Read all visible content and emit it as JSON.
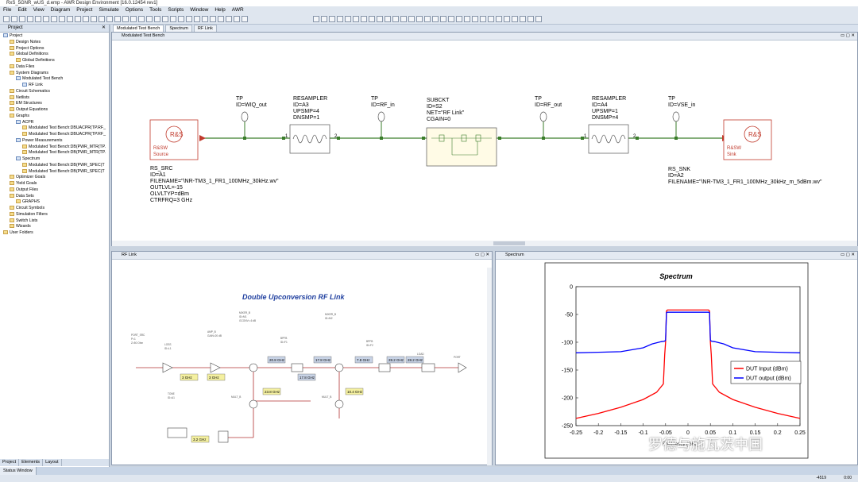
{
  "window_title": "RxS_5GNR_wUS_d.emp - AWR Design Environment [16.0.12454 rev1]",
  "menu": [
    "File",
    "Edit",
    "View",
    "Diagram",
    "Project",
    "Simulate",
    "Options",
    "Tools",
    "Scripts",
    "Window",
    "Help",
    "AWR"
  ],
  "doc_tabs": [
    "Modulated Test Bench",
    "Spectrum",
    "RF Link"
  ],
  "left_pane_title": "Project",
  "tree": [
    {
      "label": "Project",
      "indent": 0,
      "kind": "g"
    },
    {
      "label": "Design Notes",
      "indent": 1
    },
    {
      "label": "Project Options",
      "indent": 1
    },
    {
      "label": "Global Definitions",
      "indent": 1
    },
    {
      "label": "Global Definitions",
      "indent": 2
    },
    {
      "label": "Data Files",
      "indent": 1
    },
    {
      "label": "System Diagrams",
      "indent": 1
    },
    {
      "label": "Modulated Test Bench",
      "indent": 2,
      "kind": "g"
    },
    {
      "label": "RF Link",
      "indent": 3,
      "kind": "g"
    },
    {
      "label": "Circuit Schematics",
      "indent": 1
    },
    {
      "label": "Netlists",
      "indent": 1
    },
    {
      "label": "EM Structures",
      "indent": 1
    },
    {
      "label": "Output Equations",
      "indent": 1
    },
    {
      "label": "Graphs",
      "indent": 1
    },
    {
      "label": "ACPR",
      "indent": 2,
      "kind": "g"
    },
    {
      "label": "Modulated Test Bench:DBUACPR(TP.RF_",
      "indent": 3
    },
    {
      "label": "Modulated Test Bench:DBUACPR(TP.RF_",
      "indent": 3
    },
    {
      "label": "Power Measurements",
      "indent": 2,
      "kind": "g"
    },
    {
      "label": "Modulated Test Bench:DB(PWR_MTR(TP.",
      "indent": 3
    },
    {
      "label": "Modulated Test Bench:DB(PWR_MTR(TP.",
      "indent": 3
    },
    {
      "label": "Spectrum",
      "indent": 2,
      "kind": "g"
    },
    {
      "label": "Modulated Test Bench:DB(PWR_SPEC(T",
      "indent": 3
    },
    {
      "label": "Modulated Test Bench:DB(PWR_SPEC(T",
      "indent": 3
    },
    {
      "label": "Optimizer Goals",
      "indent": 1
    },
    {
      "label": "Yield Goals",
      "indent": 1
    },
    {
      "label": "Output Files",
      "indent": 1
    },
    {
      "label": "Data Sets",
      "indent": 1
    },
    {
      "label": "GRAPHS",
      "indent": 2
    },
    {
      "label": "Circuit Symbols",
      "indent": 1
    },
    {
      "label": "Simulation Filters",
      "indent": 1
    },
    {
      "label": "Switch Lists",
      "indent": 1
    },
    {
      "label": "Wizards",
      "indent": 1
    },
    {
      "label": "User Folders",
      "indent": 0
    }
  ],
  "bottom_tabs": [
    "Project",
    "Elements",
    "Layout"
  ],
  "status_window_tab": "Status Window",
  "status_coords": "-4519",
  "status_coords2": "0:00",
  "schematic": {
    "window_title": "Modulated Test Bench",
    "src": {
      "box_logo": "R&S",
      "box_label1": "R&SW",
      "box_label2": "Source",
      "name": "RS_SRC",
      "id": "ID=A1",
      "filename": "FILENAME=\"\\NR-TM3_1_FR1_100MHz_30kHz.wv\"",
      "outlvl": "OUTLVL=-15",
      "olvltyp": "OLVLTYP=dBm",
      "ctrfrq": "CTRFRQ=3 GHz"
    },
    "tp1": {
      "name": "TP",
      "id": "ID=WIQ_out"
    },
    "rs1": {
      "name": "RESAMPLER",
      "id": "ID=A3",
      "up": "UPSMP=4",
      "dn": "DNSMP=1"
    },
    "tp2": {
      "name": "TP",
      "id": "ID=RF_in"
    },
    "subckt": {
      "name": "SUBCKT",
      "id": "ID=S2",
      "net": "NET=\"RF Link\"",
      "cgain": "CGAIN=0"
    },
    "tp3": {
      "name": "TP",
      "id": "ID=RF_out"
    },
    "rs2": {
      "name": "RESAMPLER",
      "id": "ID=A4",
      "up": "UPSMP=1",
      "dn": "DNSMP=4"
    },
    "tp4": {
      "name": "TP",
      "id": "ID=VSE_in"
    },
    "snk": {
      "box_logo": "R&S",
      "box_label1": "R&SW",
      "box_label2": "Sink",
      "name": "RS_SNK",
      "id": "ID=A2",
      "filename": "FILENAME=\"\\NR-TM3_1_FR1_100MHz_30kHz_m_5dBm.wv\""
    },
    "port1": "1",
    "port2": "2"
  },
  "rflink": {
    "window_title": "RF Link",
    "diagram_title": "Double Upconversion RF Link",
    "freq_tags": [
      "3 GHz",
      "3 GHz",
      "20.8 GHz",
      "17.8 GHz",
      "17.8 GHz",
      "7.8 GHz",
      "28.2 GHz",
      "28.2 GHz",
      "23.8 GHz",
      "10.4 GHz",
      "3.2 GHz"
    ]
  },
  "spectrum": {
    "window_title": "Spectrum",
    "chart_data": {
      "type": "line",
      "title": "Spectrum",
      "xlabel": "",
      "ylabel": "",
      "xlim": [
        -0.25,
        0.25
      ],
      "ylim": [
        -250,
        0
      ],
      "x_ticks": [
        "-0.25",
        "-0.2",
        "-0.15",
        "-0.1",
        "-0.05",
        "0",
        "0.05",
        "0.1",
        "0.15",
        "0.2",
        "0.25"
      ],
      "y_ticks": [
        "0",
        "-50",
        "-100",
        "-150",
        "-200",
        "-250"
      ],
      "grid": false,
      "legend_position": "right",
      "series": [
        {
          "name": "DUT Input (dBm)",
          "color": "#ff0000",
          "x": [
            -0.25,
            -0.2,
            -0.15,
            -0.1,
            -0.07,
            -0.055,
            -0.052,
            -0.05,
            -0.048,
            -0.046,
            0.046,
            0.048,
            0.05,
            0.052,
            0.055,
            0.07,
            0.1,
            0.15,
            0.2,
            0.25
          ],
          "y": [
            -237,
            -228,
            -217,
            -203,
            -190,
            -175,
            -122,
            -100,
            -44,
            -42,
            -42,
            -44,
            -100,
            -122,
            -175,
            -190,
            -203,
            -217,
            -228,
            -237
          ]
        },
        {
          "name": "DUT output (dBm)",
          "color": "#0000ff",
          "x": [
            -0.25,
            -0.2,
            -0.15,
            -0.1,
            -0.08,
            -0.06,
            -0.052,
            -0.05,
            -0.048,
            -0.046,
            0.046,
            0.048,
            0.05,
            0.052,
            0.06,
            0.08,
            0.1,
            0.15,
            0.2,
            0.25
          ],
          "y": [
            -119,
            -118,
            -117,
            -110,
            -103,
            -99,
            -98,
            -96,
            -47,
            -46,
            -46,
            -47,
            -96,
            -98,
            -99,
            -103,
            -110,
            -117,
            -118,
            -119
          ]
        }
      ]
    },
    "x_unit_fragment": "Frequency (GHz)"
  },
  "watermark": "罗德与施瓦茨中国",
  "colors": {
    "wire": "#3a7d2a",
    "accent_red": "#cc2222"
  }
}
